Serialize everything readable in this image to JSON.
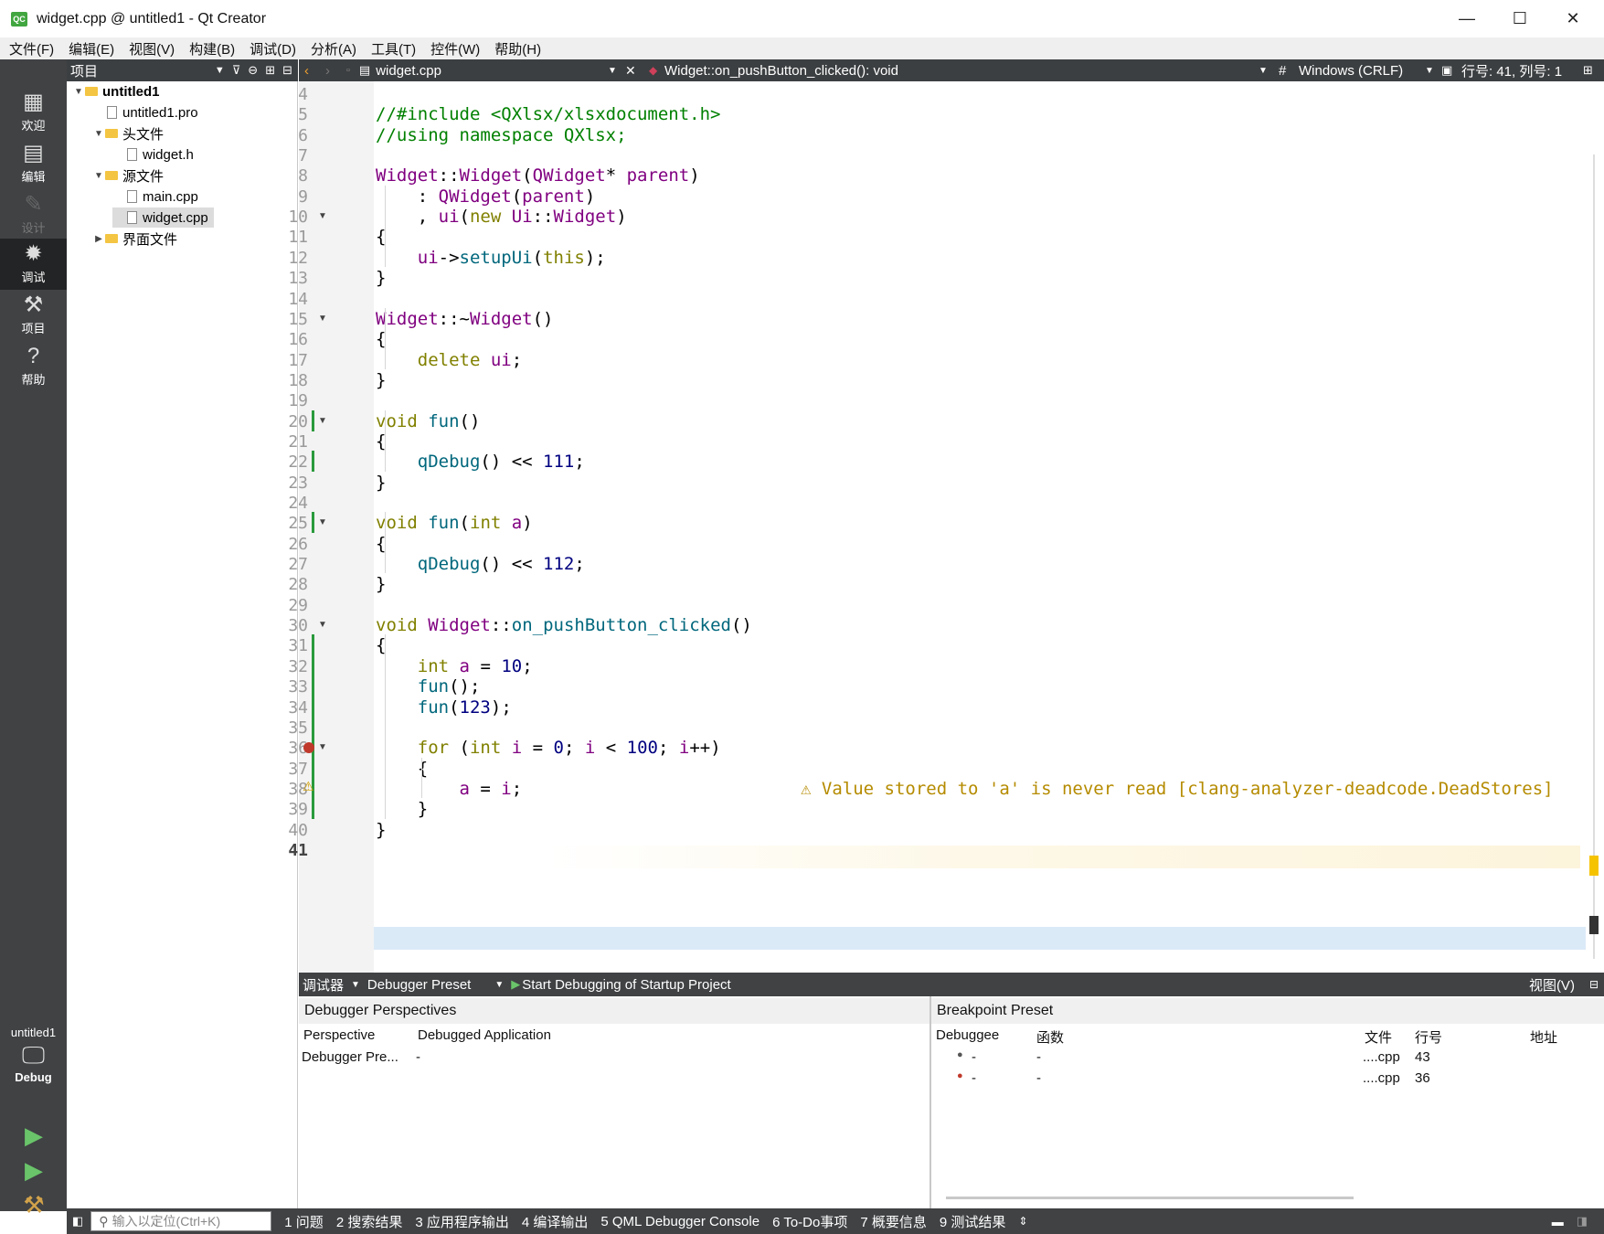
{
  "window": {
    "title": "widget.cpp @ untitled1 - Qt Creator",
    "controls": {
      "minimize": "—",
      "maximize": "☐",
      "close": "✕"
    }
  },
  "menu": [
    "文件(F)",
    "编辑(E)",
    "视图(V)",
    "构建(B)",
    "调试(D)",
    "分析(A)",
    "工具(T)",
    "控件(W)",
    "帮助(H)"
  ],
  "modes": [
    {
      "label": "欢迎",
      "icon": "grid-icon"
    },
    {
      "label": "编辑",
      "icon": "document-icon"
    },
    {
      "label": "设计",
      "icon": "pencil-icon"
    },
    {
      "label": "调试",
      "icon": "bug-icon"
    },
    {
      "label": "项目",
      "icon": "wrench-icon"
    },
    {
      "label": "帮助",
      "icon": "help-icon"
    }
  ],
  "kit": {
    "project": "untitled1",
    "config": "Debug"
  },
  "project_pane": {
    "title": "项目",
    "tree": [
      {
        "label": "untitled1",
        "depth": 0,
        "expanded": true,
        "kind": "project",
        "bold": true
      },
      {
        "label": "untitled1.pro",
        "depth": 1,
        "kind": "file"
      },
      {
        "label": "头文件",
        "depth": 1,
        "expanded": true,
        "kind": "folder"
      },
      {
        "label": "widget.h",
        "depth": 2,
        "kind": "file"
      },
      {
        "label": "源文件",
        "depth": 1,
        "expanded": true,
        "kind": "folder"
      },
      {
        "label": "main.cpp",
        "depth": 2,
        "kind": "file"
      },
      {
        "label": "widget.cpp",
        "depth": 2,
        "kind": "file",
        "selected": true
      },
      {
        "label": "界面文件",
        "depth": 1,
        "expanded": false,
        "kind": "folder"
      }
    ]
  },
  "editor_toolbar": {
    "file": "widget.cpp",
    "symbol": "Widget::on_pushButton_clicked(): void",
    "line_ending": "Windows (CRLF)",
    "position": "行号: 41, 列号: 1"
  },
  "code": {
    "lines": [
      {
        "n": "4",
        "t": ""
      },
      {
        "n": "5",
        "t": "//#include <QXlsx/xlsxdocument.h>"
      },
      {
        "n": "6",
        "t": "//using namespace QXlsx;"
      },
      {
        "n": "7",
        "t": ""
      },
      {
        "n": "8",
        "t": "Widget::Widget(QWidget* parent)"
      },
      {
        "n": "9",
        "t": "    : QWidget(parent)"
      },
      {
        "n": "10",
        "t": "    , ui(new Ui::Widget)"
      },
      {
        "n": "11",
        "t": "{"
      },
      {
        "n": "12",
        "t": "    ui->setupUi(this);"
      },
      {
        "n": "13",
        "t": "}"
      },
      {
        "n": "14",
        "t": ""
      },
      {
        "n": "15",
        "t": "Widget::~Widget()"
      },
      {
        "n": "16",
        "t": "{"
      },
      {
        "n": "17",
        "t": "    delete ui;"
      },
      {
        "n": "18",
        "t": "}"
      },
      {
        "n": "19",
        "t": ""
      },
      {
        "n": "20",
        "t": "void fun()"
      },
      {
        "n": "21",
        "t": "{"
      },
      {
        "n": "22",
        "t": "    qDebug() << 111;"
      },
      {
        "n": "23",
        "t": "}"
      },
      {
        "n": "24",
        "t": ""
      },
      {
        "n": "25",
        "t": "void fun(int a)"
      },
      {
        "n": "26",
        "t": "{"
      },
      {
        "n": "27",
        "t": "    qDebug() << 112;"
      },
      {
        "n": "28",
        "t": "}"
      },
      {
        "n": "29",
        "t": ""
      },
      {
        "n": "30",
        "t": "void Widget::on_pushButton_clicked()"
      },
      {
        "n": "31",
        "t": "{"
      },
      {
        "n": "32",
        "t": "    int a = 10;"
      },
      {
        "n": "33",
        "t": "    fun();"
      },
      {
        "n": "34",
        "t": "    fun(123);"
      },
      {
        "n": "35",
        "t": ""
      },
      {
        "n": "36",
        "t": "    for (int i = 0; i < 100; i++)"
      },
      {
        "n": "37",
        "t": "    {"
      },
      {
        "n": "38",
        "t": "        a = i;"
      },
      {
        "n": "39",
        "t": "    }"
      },
      {
        "n": "40",
        "t": "}"
      },
      {
        "n": "41",
        "t": ""
      }
    ],
    "warning": "⚠ Value stored to 'a' is never read [clang-analyzer-deadcode.DeadStores]",
    "breakpoint_line": "36",
    "warning_line": "38",
    "current_line": "41",
    "changed_lines": [
      "20",
      "22",
      "25",
      "31",
      "32",
      "33",
      "34",
      "35",
      "36",
      "37",
      "38",
      "39"
    ]
  },
  "debug_toolbar": {
    "debugger": "调试器",
    "preset": "Debugger Preset",
    "start": "Start Debugging of Startup Project",
    "view": "视图(V)"
  },
  "perspectives": {
    "title": "Debugger Perspectives",
    "headers": [
      "Perspective",
      "Debugged Application"
    ],
    "rows": [
      [
        "Debugger Pre...",
        "-"
      ]
    ]
  },
  "breakpoints": {
    "title": "Breakpoint Preset",
    "headers": [
      "Debuggee",
      "函数",
      "文件",
      "行号",
      "地址"
    ],
    "rows": [
      [
        "-",
        "-",
        "....cpp",
        "43",
        ""
      ],
      [
        "-",
        "-",
        "....cpp",
        "36",
        ""
      ]
    ]
  },
  "statusbar": {
    "locator_placeholder": "输入以定位(Ctrl+K)",
    "tabs": [
      "1 问题",
      "2 搜索结果",
      "3 应用程序输出",
      "4 编译输出",
      "5 QML Debugger Console",
      "6 To-Do事项",
      "7 概要信息",
      "9 测试结果"
    ]
  },
  "colors": {
    "keyword": "#808000",
    "type": "#800080",
    "func": "#00677c",
    "number": "#000080",
    "comment": "#008000",
    "current_line_bg": "#dbeaf7"
  }
}
